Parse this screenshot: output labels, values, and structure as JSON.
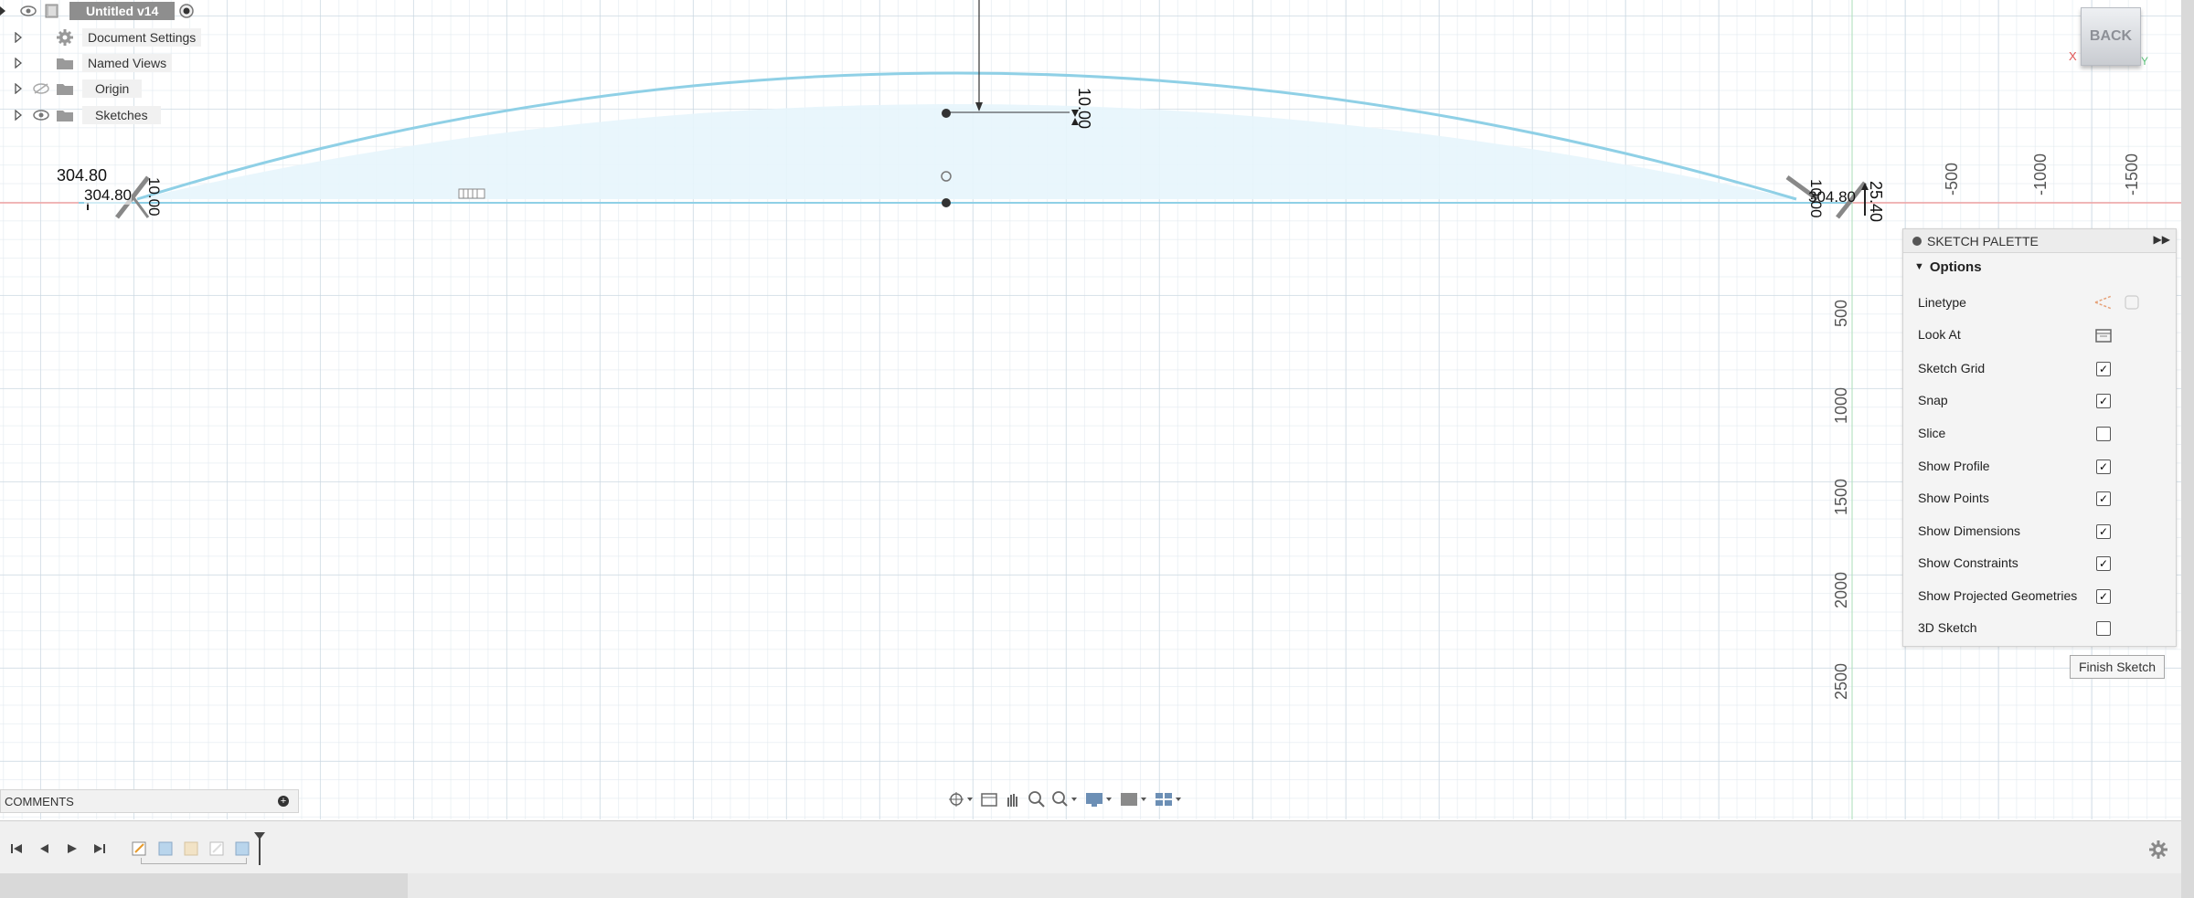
{
  "browser": {
    "root_label": "Untitled v14",
    "items": [
      {
        "label": "Document Settings",
        "icon": "gear-icon"
      },
      {
        "label": "Named Views",
        "icon": "folder-icon"
      },
      {
        "label": "Origin",
        "icon": "folder-icon"
      },
      {
        "label": "Sketches",
        "icon": "folder-icon"
      }
    ]
  },
  "viewcube": {
    "label": "BACK",
    "x_axis": "X",
    "y_axis": "Y"
  },
  "ruler": {
    "horizontal_ticks": [
      "-500",
      "-1000",
      "-1500"
    ],
    "vertical_ticks": [
      "500",
      "1000",
      "1500",
      "2000",
      "2500"
    ]
  },
  "dimensions": {
    "left_length": "304.80",
    "left_length_2": "304.80",
    "left_vertical": "10.00",
    "top_height": "10.00",
    "right_length": "304.80",
    "right_vertical": "10.00",
    "right_offset": "25.40"
  },
  "palette": {
    "title": "SKETCH PALETTE",
    "section": "Options",
    "options": [
      {
        "label": "Linetype",
        "control": "icons"
      },
      {
        "label": "Look At",
        "control": "icon"
      },
      {
        "label": "Sketch Grid",
        "checked": true
      },
      {
        "label": "Snap",
        "checked": true
      },
      {
        "label": "Slice",
        "checked": false
      },
      {
        "label": "Show Profile",
        "checked": true
      },
      {
        "label": "Show Points",
        "checked": true
      },
      {
        "label": "Show Dimensions",
        "checked": true
      },
      {
        "label": "Show Constraints",
        "checked": true
      },
      {
        "label": "Show Projected Geometries",
        "checked": true
      },
      {
        "label": "3D Sketch",
        "checked": false
      }
    ],
    "finish_label": "Finish Sketch"
  },
  "comments": {
    "label": "COMMENTS"
  },
  "colors": {
    "sketch_curve": "#8fd0e6",
    "profile_fill": "#e7f5fc",
    "x_axis_line": "#f2a3a3",
    "accent": "#6aa7d8"
  }
}
